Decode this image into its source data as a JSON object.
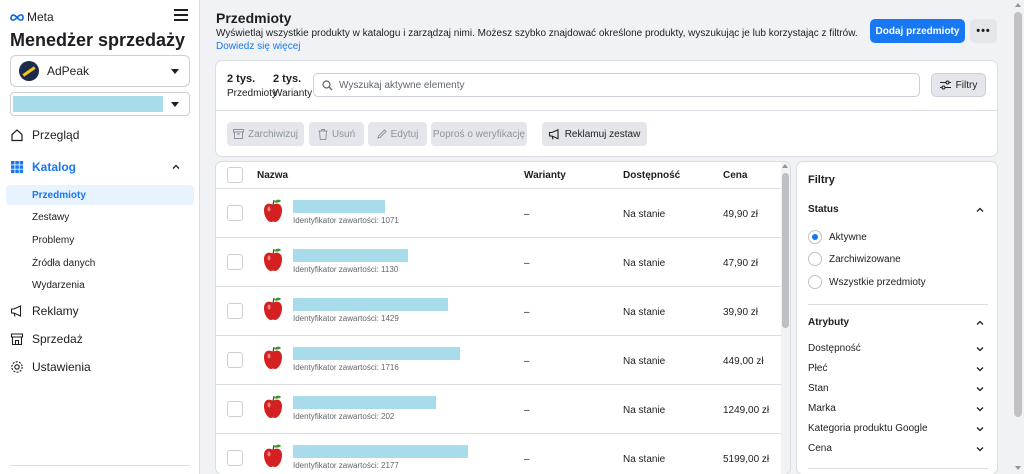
{
  "sidebar": {
    "brand": "Meta",
    "title": "Menedżer sprzedaży",
    "account": "AdPeak",
    "nav": {
      "overview": "Przegląd",
      "catalog": "Katalog",
      "items": "Przedmioty",
      "sets": "Zestawy",
      "problems": "Problemy",
      "sources": "Źródła danych",
      "events": "Wydarzenia",
      "ads": "Reklamy",
      "sales": "Sprzedaż",
      "settings": "Ustawienia"
    }
  },
  "header": {
    "title": "Przedmioty",
    "description": "Wyświetlaj wszystkie produkty w katalogu i zarządzaj nimi. Możesz szybko znajdować określone produkty, wyszukując je lub korzystając z filtrów.",
    "learn_more": "Dowiedz się więcej",
    "add_button": "Dodaj przedmioty",
    "more_button": "•••"
  },
  "stats": [
    {
      "value": "2 tys.",
      "label": "Przedmioty"
    },
    {
      "value": "2 tys.",
      "label": "Warianty"
    }
  ],
  "search": {
    "placeholder": "Wyszukaj aktywne elementy"
  },
  "filters_button": "Filtry",
  "actions": {
    "archive": "Zarchiwizuj",
    "delete": "Usuń",
    "edit": "Edytuj",
    "review": "Poproś o weryfikację",
    "advertise": "Reklamuj zestaw"
  },
  "table": {
    "columns": [
      "Nazwa",
      "Warianty",
      "Dostępność",
      "Cena"
    ],
    "rows": [
      {
        "id": "Identyfikator zawartości: 1071",
        "variants": "–",
        "availability": "Na stanie",
        "price": "49,90 zł"
      },
      {
        "id": "Identyfikator zawartości: 1130",
        "variants": "–",
        "availability": "Na stanie",
        "price": "47,90 zł"
      },
      {
        "id": "Identyfikator zawartości: 1429",
        "variants": "–",
        "availability": "Na stanie",
        "price": "39,90 zł"
      },
      {
        "id": "Identyfikator zawartości: 1716",
        "variants": "–",
        "availability": "Na stanie",
        "price": "449,00 zł"
      },
      {
        "id": "Identyfikator zawartości: 202",
        "variants": "–",
        "availability": "Na stanie",
        "price": "1249,00 zł"
      },
      {
        "id": "Identyfikator zawartości: 2177",
        "variants": "–",
        "availability": "Na stanie",
        "price": "5199,00 zł"
      }
    ]
  },
  "filters_panel": {
    "title": "Filtry",
    "status_label": "Status",
    "status_options": [
      "Aktywne",
      "Zarchiwizowane",
      "Wszystkie przedmioty"
    ],
    "selected_status": "Aktywne",
    "attributes_label": "Atrybuty",
    "attributes": [
      "Dostępność",
      "Płeć",
      "Stan",
      "Marka",
      "Kategoria produktu Google",
      "Cena"
    ]
  },
  "colors": {
    "accent": "#1877f2",
    "redaction": "#a8dcea",
    "background": "#f0f2f5"
  }
}
